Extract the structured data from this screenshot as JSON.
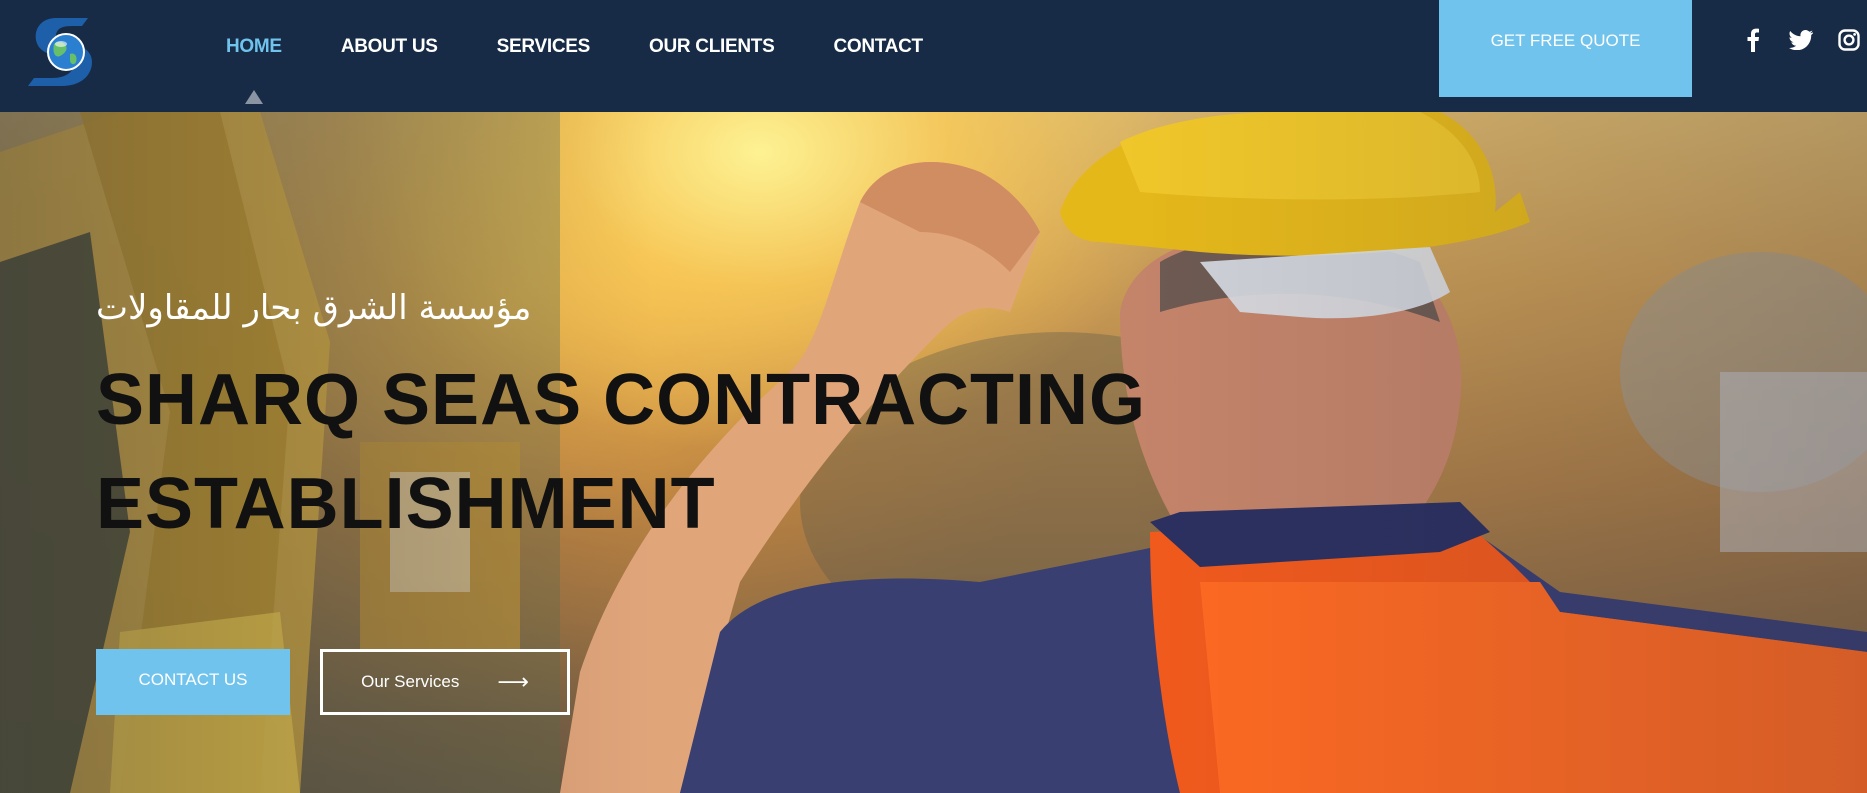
{
  "brand": {
    "logo_icon": "globe-s-logo-icon"
  },
  "nav": {
    "items": [
      {
        "label": "HOME",
        "active": true
      },
      {
        "label": "ABOUT US",
        "active": false
      },
      {
        "label": "SERVICES",
        "active": false
      },
      {
        "label": "OUR CLIENTS",
        "active": false
      },
      {
        "label": "CONTACT",
        "active": false
      }
    ]
  },
  "header": {
    "quote_button": "GET FREE QUOTE",
    "social_icons": [
      "facebook-icon",
      "twitter-icon",
      "instagram-icon"
    ]
  },
  "hero": {
    "arabic_title": "مؤسسة الشرق بحار للمقاولات",
    "title_line1": "SHARQ SEAS CONTRACTING",
    "title_line2": "ESTABLISHMENT",
    "contact_button": "CONTACT US",
    "services_button": "Our Services",
    "services_arrow": "⟶"
  },
  "colors": {
    "header_bg": "#172b46",
    "accent": "#6fc3ec",
    "title_text": "#111111"
  }
}
